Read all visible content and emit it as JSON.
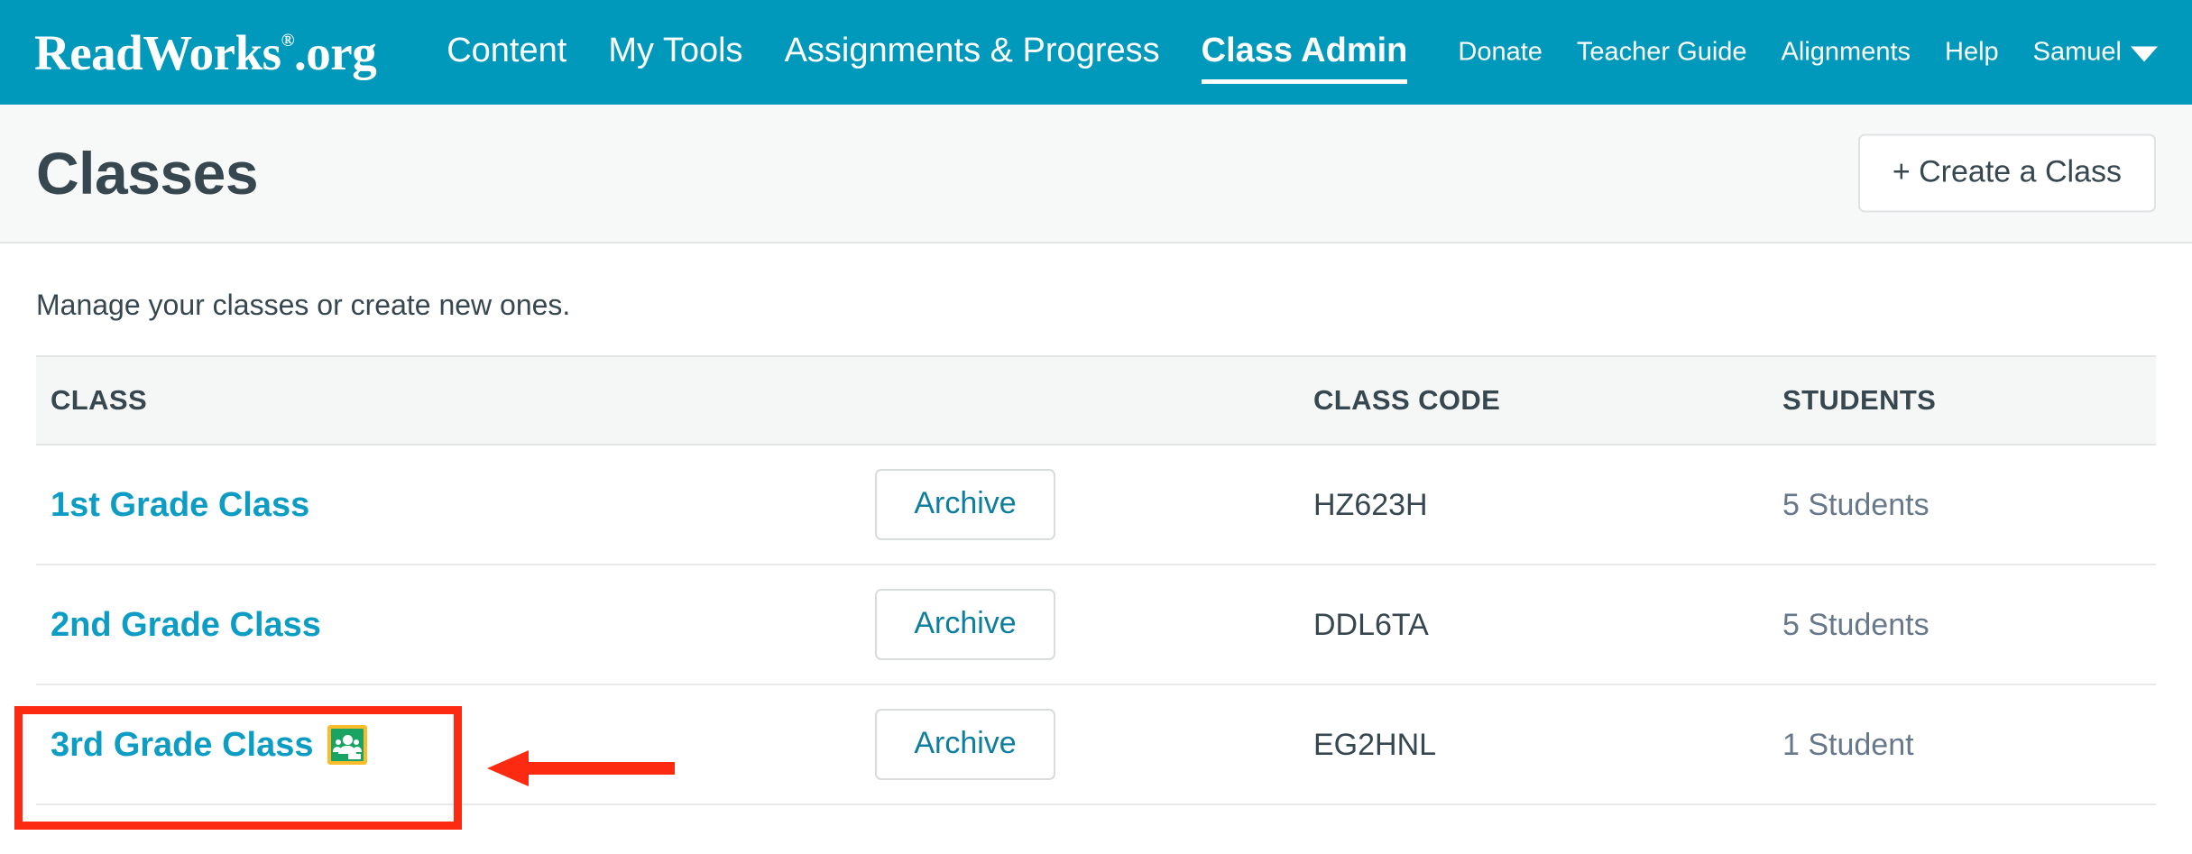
{
  "brand": {
    "logo_main": "ReadWorks",
    "logo_reg": "®",
    "logo_tld": ".org",
    "accent_teal": "#0099bb",
    "link_teal": "#0d9dc4",
    "annotation_red": "#fc2a10"
  },
  "nav": {
    "main": [
      {
        "label": "Content",
        "active": false
      },
      {
        "label": "My Tools",
        "active": false
      },
      {
        "label": "Assignments & Progress",
        "active": false
      },
      {
        "label": "Class Admin",
        "active": true
      }
    ],
    "right": [
      {
        "label": "Donate"
      },
      {
        "label": "Teacher Guide"
      },
      {
        "label": "Alignments"
      },
      {
        "label": "Help"
      }
    ],
    "user": {
      "name": "Samuel",
      "caret_icon": "chevron-down-icon"
    }
  },
  "header": {
    "title": "Classes",
    "create_button": "+ Create a Class"
  },
  "main": {
    "subtitle": "Manage your classes or create new ones.",
    "table": {
      "columns": [
        "CLASS",
        "",
        "CLASS CODE",
        "STUDENTS"
      ],
      "rows": [
        {
          "class_name": "1st Grade Class",
          "has_google_classroom": false,
          "archive_label": "Archive",
          "class_code": "HZ623H",
          "students": "5 Students"
        },
        {
          "class_name": "2nd Grade Class",
          "has_google_classroom": false,
          "archive_label": "Archive",
          "class_code": "DDL6TA",
          "students": "5 Students"
        },
        {
          "class_name": "3rd Grade Class",
          "has_google_classroom": true,
          "google_classroom_icon": "google-classroom-icon",
          "archive_label": "Archive",
          "class_code": "EG2HNL",
          "students": "1 Student"
        }
      ]
    }
  },
  "annotations": {
    "highlight_box_target": "3rd Grade Class",
    "arrow_icon": "left-arrow-annotation",
    "arrow_direction": "left"
  }
}
